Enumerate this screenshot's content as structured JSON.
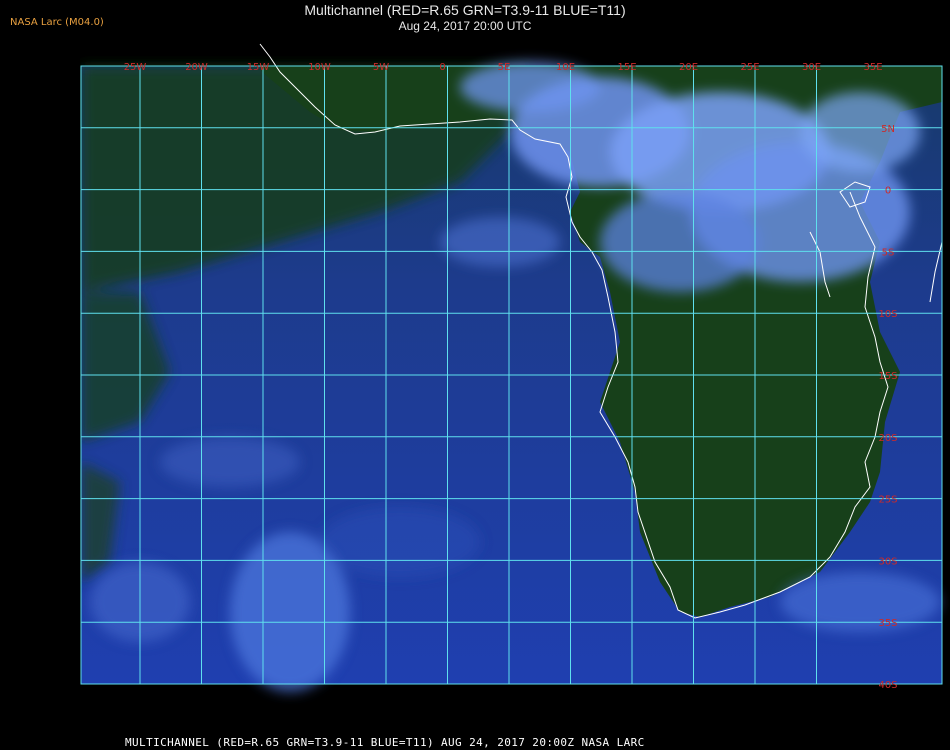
{
  "header": {
    "credit": "NASA Larc (M04.0)",
    "title": "Multichannel (RED=R.65 GRN=T3.9-11 BLUE=T11)",
    "subtitle": "Aug 24, 2017 20:00 UTC"
  },
  "footer": {
    "caption": "MULTICHANNEL (RED=R.65 GRN=T3.9-11 BLUE=T11) AUG 24, 2017 20:00Z  NASA LARC"
  },
  "grid": {
    "color": "#5fe0ee",
    "longitude_labels": [
      "25W",
      "20W",
      "15W",
      "10W",
      "5W",
      "0",
      "5E",
      "10E",
      "15E",
      "20E",
      "25E",
      "30E",
      "35E"
    ],
    "latitude_labels": [
      "5N",
      "0",
      "5S",
      "10S",
      "15S",
      "20S",
      "25S",
      "30S",
      "35S",
      "40S"
    ]
  },
  "colors": {
    "ocean": "#1f3fa8",
    "land": "#143a14",
    "cloud": "#6c96f0",
    "coastline": "#ffffff",
    "label": "#cc2a2a"
  }
}
